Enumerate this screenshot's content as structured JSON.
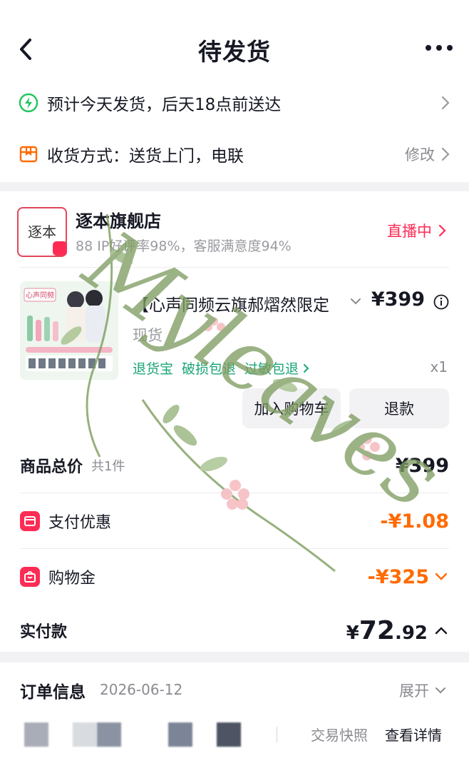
{
  "header": {
    "title": "待发货"
  },
  "delivery": {
    "eta_text": "预计今天发货，后天18点前送达",
    "method_text": "收货方式：送货上门，电联",
    "modify_label": "修改"
  },
  "store": {
    "logo_text": "逐本",
    "name": "逐本旗舰店",
    "rating": "88 IP好评率98%，客服满意度94%",
    "live_label": "直播中"
  },
  "product": {
    "title": "【心声同频云旗郝熠然限定",
    "price": "¥399",
    "stock": "现货",
    "guarantees": [
      "退货宝",
      "破损包退",
      "过敏包退"
    ],
    "qty": "x1",
    "thumb_text": "心声同频"
  },
  "actions": {
    "cart": "加入购物车",
    "refund": "退款"
  },
  "summary": {
    "total_label": "商品总价",
    "total_count": "共1件",
    "total_value": "¥399",
    "pay_discount_label": "支付优惠",
    "pay_discount_value": "-¥1.08",
    "shopping_gold_label": "购物金",
    "shopping_gold_value": "-¥325",
    "paid_label": "实付款",
    "paid_symbol": "¥",
    "paid_int": "72",
    "paid_dec": ".92"
  },
  "order": {
    "title": "订单信息",
    "date": "2026-06-12",
    "expand_label": "展开",
    "snapshot_label": "交易快照",
    "details_label": "查看详情"
  },
  "watermark": {
    "text": "Myleaves"
  },
  "colors": {
    "accent_red": "#fe2c55",
    "discount_orange": "#ff6a00",
    "guarantee_green": "#1aa575",
    "eta_green": "#22c55e"
  }
}
